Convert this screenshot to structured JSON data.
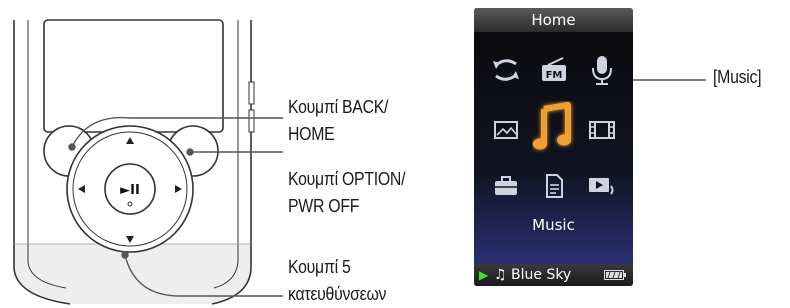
{
  "callouts": {
    "back_home_line1": "Κουμπί BACK/",
    "back_home_line2": "HOME",
    "option_line1": "Κουμπί OPTION/",
    "option_line2": "PWR OFF",
    "five_way_line1": "Κουμπί 5",
    "five_way_line2": "κατευθύνσεων",
    "music": "[Music]"
  },
  "screen": {
    "title": "Home",
    "selected_label": "Music",
    "status": {
      "play_icon": "play-indicator-icon",
      "note_icon": "music-note-icon",
      "track": "Blue Sky",
      "battery_icon": "battery-icon"
    },
    "icons": [
      "repeat-icon",
      "fm-radio-icon",
      "microphone-icon",
      "photo-icon",
      "music-icon",
      "video-icon",
      "settings-toolbox-icon",
      "document-icon",
      "now-playing-icon"
    ],
    "fm_text": "FM"
  },
  "colors": {
    "selected_glow": "#f0a030",
    "play_green": "#44dd33",
    "screen_bg_bottom": "#2a2f72"
  },
  "device": {
    "play_pause_glyph": "►II"
  }
}
